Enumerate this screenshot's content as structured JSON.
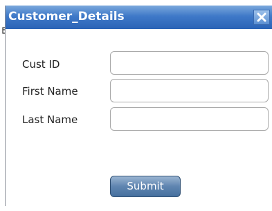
{
  "window": {
    "title": "Customer_Details",
    "close_icon": "close-x-icon"
  },
  "form": {
    "fields": [
      {
        "label": "Cust ID",
        "value": "",
        "placeholder": ""
      },
      {
        "label": "First Name",
        "value": "",
        "placeholder": ""
      },
      {
        "label": "Last Name",
        "value": "",
        "placeholder": ""
      }
    ],
    "submit_label": "Submit"
  },
  "colors": {
    "titlebar": "#3f79c8",
    "title_text": "#ffffff",
    "button": "#5f85b0"
  }
}
